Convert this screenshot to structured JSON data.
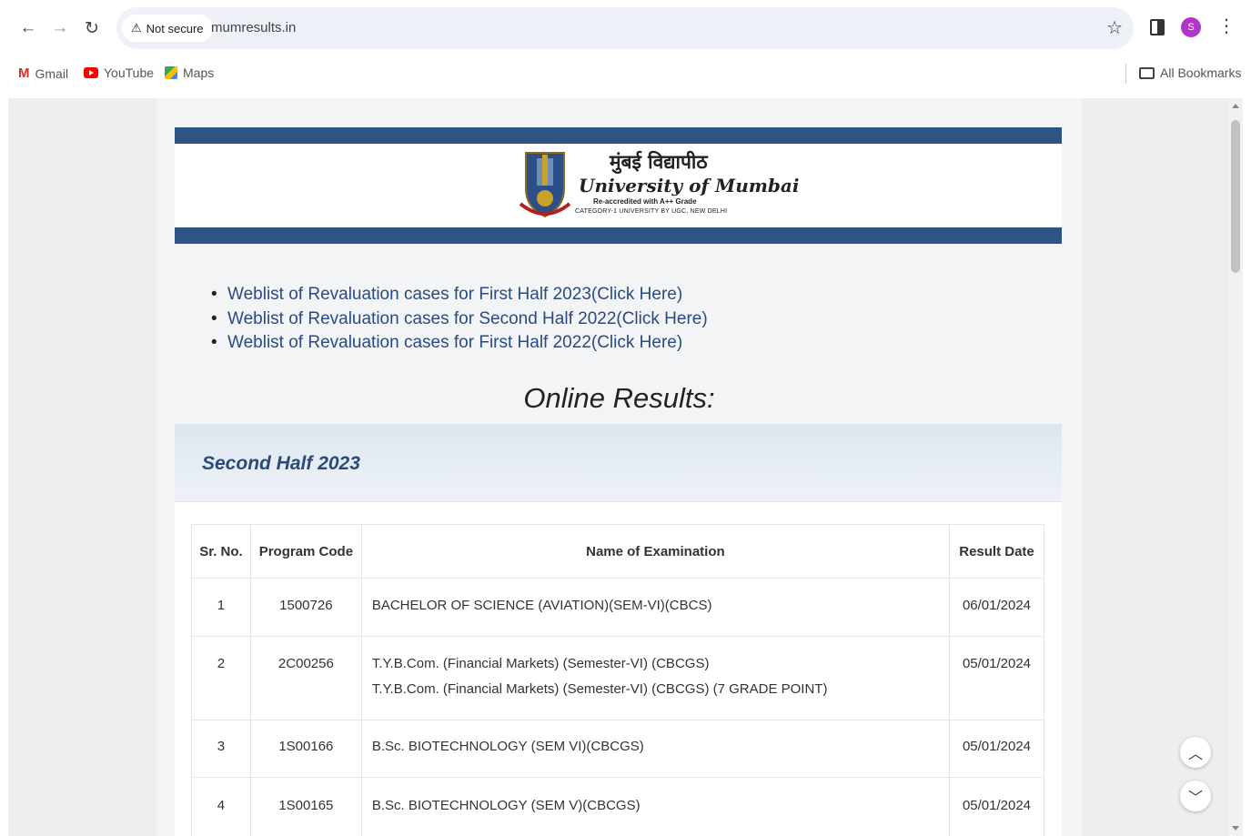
{
  "browser": {
    "security_label": "Not secure",
    "url": "mumresults.in",
    "avatar_initial": "S",
    "bookmarks": {
      "gmail": "Gmail",
      "youtube": "YouTube",
      "maps": "Maps",
      "all": "All Bookmarks"
    }
  },
  "header": {
    "marathi_name": "मुंबई विद्यापीठ",
    "english_name": "University of Mumbai",
    "accreditation": "Re-accredited with A++ Grade",
    "category": "CATEGORY-1 UNIVERSITY BY UGC, NEW DELHI"
  },
  "weblist": [
    "Weblist of Revaluation cases for First Half 2023(Click Here)",
    "Weblist of Revaluation cases for Second Half 2022(Click Here)",
    "Weblist of Revaluation cases for First Half 2022(Click Here)"
  ],
  "online_results_title": "Online Results:",
  "panel": {
    "title": "Second Half 2023",
    "columns": [
      "Sr. No.",
      "Program Code",
      "Name of Examination",
      "Result Date"
    ],
    "rows": [
      {
        "sr": "1",
        "code": "1500726",
        "names": [
          "BACHELOR OF SCIENCE (AVIATION)(SEM-VI)(CBCS)"
        ],
        "date": "06/01/2024"
      },
      {
        "sr": "2",
        "code": "2C00256",
        "names": [
          "T.Y.B.Com. (Financial Markets) (Semester-VI) (CBCGS)",
          "T.Y.B.Com. (Financial Markets) (Semester-VI) (CBCGS) (7 GRADE POINT)"
        ],
        "date": "05/01/2024"
      },
      {
        "sr": "3",
        "code": "1S00166",
        "names": [
          "B.Sc. BIOTECHNOLOGY (SEM VI)(CBCGS)"
        ],
        "date": "05/01/2024"
      },
      {
        "sr": "4",
        "code": "1S00165",
        "names": [
          "B.Sc. BIOTECHNOLOGY (SEM V)(CBCGS)"
        ],
        "date": "05/01/2024"
      }
    ]
  },
  "colors": {
    "banner_bar": "#2d5483",
    "link": "#2a4a85",
    "panel_title": "#2a4a7a"
  }
}
